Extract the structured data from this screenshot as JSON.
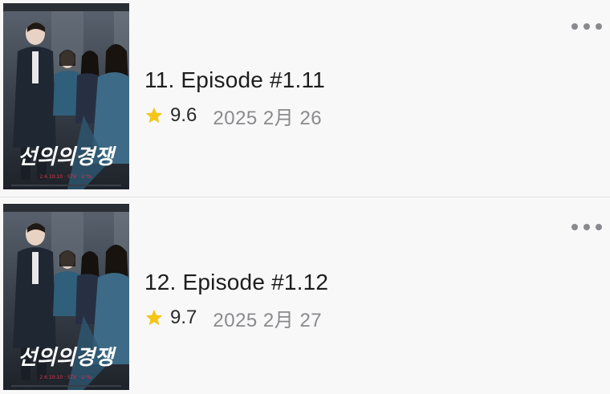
{
  "episodes": [
    {
      "title": "11. Episode #1.11",
      "rating": "9.6",
      "date": "2025 2月 26",
      "poster": {
        "logo_text": "선의의경쟁",
        "credit_line": "2.6 10:10 ·  STV · U⁺tv"
      },
      "icons": {
        "rating": "star-icon",
        "more": "more-horizontal-icon"
      }
    },
    {
      "title": "12. Episode #1.12",
      "rating": "9.7",
      "date": "2025 2月 27",
      "poster": {
        "logo_text": "선의의경쟁",
        "credit_line": "2.6 10:10 ·  STV · U⁺tv"
      },
      "icons": {
        "rating": "star-icon",
        "more": "more-horizontal-icon"
      }
    }
  ],
  "colors": {
    "background": "#f8f8f8",
    "star": "#f5c518",
    "title": "#1d1d1f",
    "date": "#8a8a8e",
    "logo_accent": "#e0314b"
  }
}
